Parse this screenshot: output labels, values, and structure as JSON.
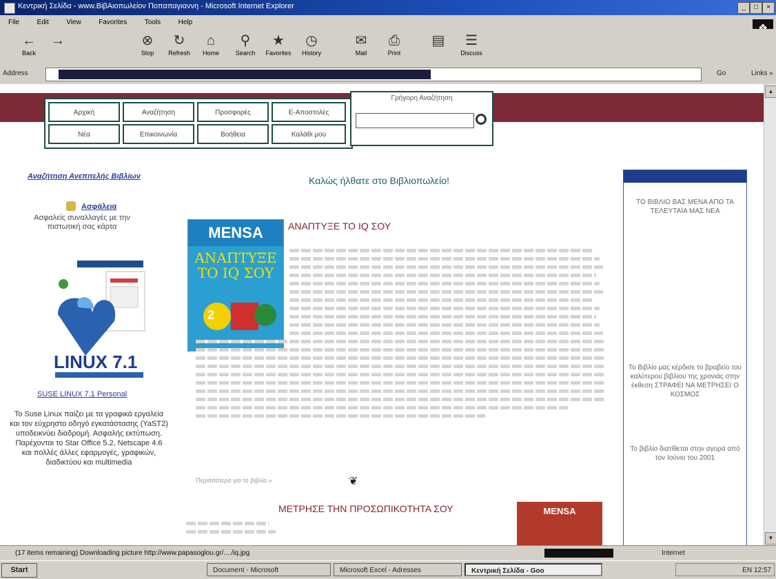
{
  "window": {
    "title": "Κεντρική Σελίδα - www.BiβAιoπωλείον Πoπαπαγιαννη - Microsoft Internet Explorer",
    "controls": [
      "_",
      "□",
      "×"
    ]
  },
  "menu": [
    "File",
    "Edit",
    "View",
    "Favorites",
    "Tools",
    "Help"
  ],
  "toolbar": [
    {
      "label": "Back",
      "icon": "back-arrow-icon",
      "glyph": "←"
    },
    {
      "label": "",
      "icon": "forward-arrow-icon",
      "glyph": "→"
    },
    {
      "label": "Stop",
      "icon": "stop-icon",
      "glyph": "⊗"
    },
    {
      "label": "Refresh",
      "icon": "refresh-icon",
      "glyph": "↻"
    },
    {
      "label": "Home",
      "icon": "home-icon",
      "glyph": "⌂"
    },
    {
      "label": "Search",
      "icon": "search-icon",
      "glyph": "⚲"
    },
    {
      "label": "Favorites",
      "icon": "favorites-icon",
      "glyph": "★"
    },
    {
      "label": "History",
      "icon": "history-icon",
      "glyph": "◷"
    },
    {
      "label": "Mail",
      "icon": "mail-icon",
      "glyph": "✉"
    },
    {
      "label": "Print",
      "icon": "print-icon",
      "glyph": "⎙"
    },
    {
      "label": "",
      "icon": "edit-icon",
      "glyph": "▤"
    },
    {
      "label": "Discuss",
      "icon": "discuss-icon",
      "glyph": "☰"
    }
  ],
  "address": {
    "label": "Address",
    "go": "Go",
    "links": "Links »"
  },
  "nav": {
    "row1": [
      "Αρχική",
      "Αναζήτηση",
      "Προσφορές",
      "Ε-Αποστολές"
    ],
    "row2": [
      "Νέα",
      "Επικοινωνία",
      "Βοήθεια",
      "Καλάθι μου"
    ],
    "search_caption": "Γρήγορη Αναζήτηση"
  },
  "welcome": "Καλώς ήλθατε στο Βιβλιοπωλείο!",
  "left": {
    "top_link": "Αναζήτηση Ανεπιτελής Βιβλίων",
    "lock_name": "Ασφάλεια",
    "lock_text": "Ασφαλείς συναλλαγές με την πιστωτική σας κάρτα",
    "suse_box": "LINUX 7.1",
    "suse_link": "SUSE LINUX 7.1 Personal",
    "suse_text": "Το Suse Linux παίζει με τα γραφικά εργαλεία και τον εύχρηστο οδηγό εγκατάστασης (YaST2) υποδεικνύει διαδρομή. Ασφαλής εκτύπωση. Παρέχονται το Star Office 5.2, Netscape 4.6 και πολλές άλλες εφαρμογές, γραφικών, διαδικτύου και multimedia"
  },
  "right": {
    "text1": "ΤΟ ΒΙΒΛΙΟ ΒΑΣ ΜΕΝΑ ΑΠΟ ΤΑ ΤΕΛΕΥΤΑΙΑ ΜΑΣ ΝΕΑ",
    "text2": "Το Βιβλίο μας κέρδισε το βραβείο του καλύτερου βιβλίου της χρονιάς στην έκθεση ΣΤΡΑΦΕΙ ΝΑ ΜΕΤΡΗΣΕΙ Ο ΚΟΣΜΟΣ",
    "text3": "Το βιβλίο διατίθεται στην αγορά από τον Ιούνιο του 2001"
  },
  "book1": {
    "brand": "MENSA",
    "cover_title": "ΑΝΑΠΤΥΞΕ ΤΟ IQ ΣΟΥ",
    "cover_number": "2",
    "title": "ΑΝΑΠΤΥΞΕ ΤΟ IQ ΣΟΥ"
  },
  "more_link": "Περισσότερα για το βιβλίο »",
  "book2": {
    "brand": "MENSA",
    "title": "ΜΕΤΡΗΣΕ ΤΗΝ ΠΡΟΣΩΠΙΚΟΤΗΤΑ ΣΟΥ"
  },
  "status": {
    "text": "(17 items remaining) Downloading picture http://www.papasoglou.gr/..../iq.jpg",
    "zone": "Internet"
  },
  "taskbar": {
    "start": "Start",
    "tasks": [
      "Document - Microsoft",
      "Microsoft Excel - Adresses",
      "Κεντρική Σελίδα - Goo"
    ],
    "tray": "EN 12:57"
  }
}
